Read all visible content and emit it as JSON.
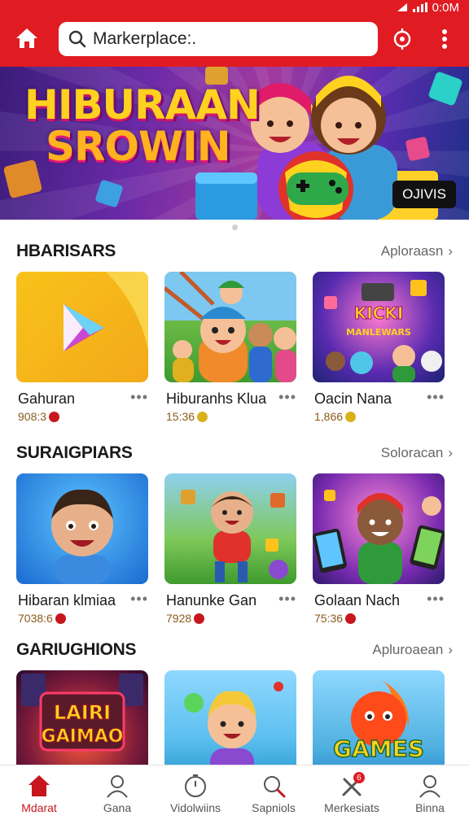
{
  "status": {
    "time": "0:0M"
  },
  "search": {
    "text": "Markerplace:."
  },
  "banner": {
    "title_line1": "HIBURAAN",
    "title_line2": "SROWIN",
    "button": "OJIVIS"
  },
  "sections": [
    {
      "title": "HBARISARS",
      "more": "Aploraasn",
      "items": [
        {
          "name": "Gahuran",
          "sub": "908:3",
          "thumb": "play-store-logo",
          "badge_color": "#c8161d"
        },
        {
          "name": "Hiburanhs Klua",
          "sub": "15:36",
          "thumb": "cartoon-kids-park",
          "badge_color": "#d9b21a"
        },
        {
          "name": "Oacin Nana",
          "sub": "1,866",
          "thumb": "arcade-characters",
          "badge_color": "#d9b21a"
        }
      ]
    },
    {
      "title": "SURAIGPIARS",
      "more": "Soloracan",
      "items": [
        {
          "name": "Hibaran klmiaa",
          "sub": "7038:6",
          "thumb": "cartoon-boy-portrait",
          "badge_color": "#c8161d"
        },
        {
          "name": "Hanunke Gan",
          "sub": "7928",
          "thumb": "cartoon-boy-running",
          "badge_color": "#c8161d"
        },
        {
          "name": "Golaan Nach",
          "sub": "75:36",
          "thumb": "cartoon-boy-phones",
          "badge_color": "#c8161d"
        }
      ]
    },
    {
      "title": "GARIUGHIONS",
      "more": "Apluroaean",
      "items": [
        {
          "name": "",
          "sub": "",
          "thumb": "arcade-game-sign",
          "badge_color": ""
        },
        {
          "name": "",
          "sub": "",
          "thumb": "cartoon-boy-beach",
          "badge_color": ""
        },
        {
          "name": "",
          "sub": "",
          "thumb": "games-fire-logo",
          "badge_color": ""
        }
      ]
    }
  ],
  "section3_cards": {
    "card1_sign_line1": "LAIRI",
    "card1_sign_line2": "GAIMAO",
    "card3_logo": "GAMES"
  },
  "nav": [
    {
      "label": "Mdarat",
      "icon": "home-icon",
      "active": true
    },
    {
      "label": "Gana",
      "icon": "user-icon",
      "active": false
    },
    {
      "label": "Vidolwiins",
      "icon": "timer-icon",
      "active": false
    },
    {
      "label": "Sapniols",
      "icon": "search-icon",
      "active": false
    },
    {
      "label": "Merkesiats",
      "icon": "tools-icon",
      "active": false,
      "badge": "6"
    },
    {
      "label": "Binna",
      "icon": "profile-icon",
      "active": false
    }
  ],
  "colors": {
    "brand_red": "#e01b22",
    "active_red": "#c8161d"
  }
}
